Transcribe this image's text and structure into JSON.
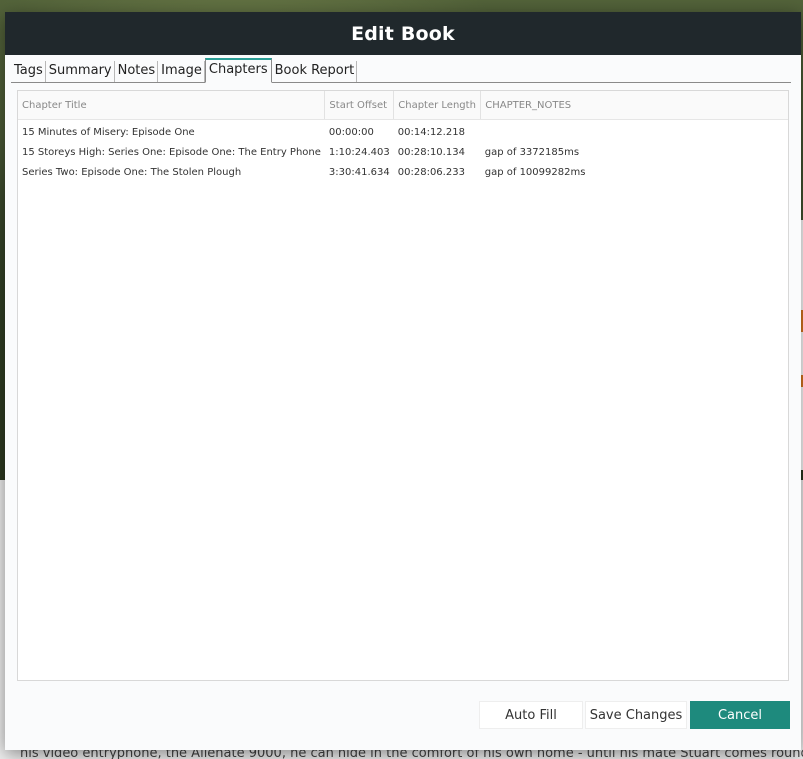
{
  "dialog": {
    "title": "Edit Book"
  },
  "tabs": [
    {
      "label": "Tags",
      "active": false
    },
    {
      "label": "Summary",
      "active": false
    },
    {
      "label": "Notes",
      "active": false
    },
    {
      "label": "Image",
      "active": false
    },
    {
      "label": "Chapters",
      "active": true
    },
    {
      "label": "Book Report",
      "active": false
    }
  ],
  "chapters_table": {
    "columns": [
      "Chapter Title",
      "Start Offset",
      "Chapter Length",
      "CHAPTER_NOTES"
    ],
    "rows": [
      {
        "title": "15 Minutes of Misery: Episode One",
        "start": "00:00:00",
        "length": "00:14:12.218",
        "notes": ""
      },
      {
        "title": "15 Storeys High: Series One: Episode One: The Entry Phone",
        "start": "1:10:24.403",
        "length": "00:28:10.134",
        "notes": "gap of 3372185ms"
      },
      {
        "title": "Series Two: Episode One: The Stolen Plough",
        "start": "3:30:41.634",
        "length": "00:28:06.233",
        "notes": "gap of 10099282ms"
      }
    ]
  },
  "footer": {
    "auto_fill_label": "Auto Fill",
    "save_label": "Save Changes",
    "cancel_label": "Cancel"
  },
  "background": {
    "footer_text": "his video entryphone, the Alienate 9000, he can hide in the comfort of his own home - until his mate Stuart comes round, and"
  },
  "colors": {
    "header_bg": "#20282c",
    "accent": "#1e8a7d",
    "active_tab_border": "#2a9d95"
  }
}
